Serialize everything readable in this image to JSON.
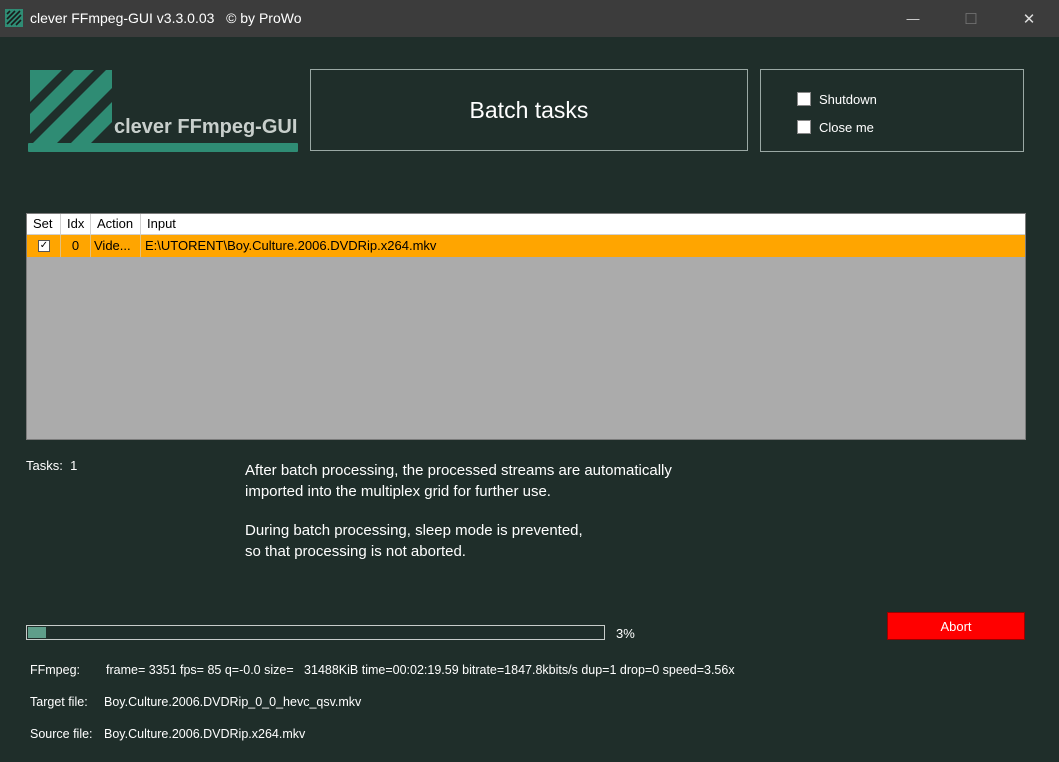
{
  "window": {
    "title": "clever FFmpeg-GUI v3.3.0.03   © by ProWo",
    "minimize_glyph": "—",
    "maximize_glyph": "☐",
    "close_glyph": "✕"
  },
  "logo": {
    "text": "clever FFmpeg-GUI"
  },
  "header": {
    "title": "Batch tasks"
  },
  "options": {
    "shutdown_label": "Shutdown",
    "close_me_label": "Close me"
  },
  "grid": {
    "columns": [
      "Set",
      "Idx",
      "Action",
      "Input"
    ],
    "rows": [
      {
        "set": true,
        "set_glyph": "✓",
        "idx": "0",
        "action": "Vide...",
        "input": "E:\\UTORENT\\Boy.Culture.2006.DVDRip.x264.mkv"
      }
    ]
  },
  "tasks": {
    "label": "Tasks:",
    "count": "1"
  },
  "info": {
    "line1": "After batch processing, the processed streams are automatically",
    "line2": "imported into the multiplex grid for further use.",
    "line3": "During batch processing, sleep mode is prevented,",
    "line4": "so that processing is not aborted."
  },
  "progress": {
    "value": 0.03,
    "label": "3%"
  },
  "abort_label": "Abort",
  "status": {
    "ffmpeg_label": "FFmpeg:",
    "ffmpeg_value": "frame= 3351 fps= 85 q=-0.0 size=   31488KiB time=00:02:19.59 bitrate=1847.8kbits/s dup=1 drop=0 speed=3.56x",
    "target_label": "Target file:",
    "target_value": "Boy.Culture.2006.DVDRip_0_0_hevc_qsv.mkv",
    "source_label": "Source file:",
    "source_value": "Boy.Culture.2006.DVDRip.x264.mkv"
  },
  "colors": {
    "background": "#1f2e2a",
    "accent": "#2f8c74",
    "selected_row": "#ffa500",
    "abort": "#ff0000",
    "progress_fill": "#5f9e8a"
  },
  "icons": [
    "app-icon",
    "minimize-icon",
    "maximize-icon",
    "close-icon",
    "logo-icon",
    "checkbox-icon"
  ]
}
